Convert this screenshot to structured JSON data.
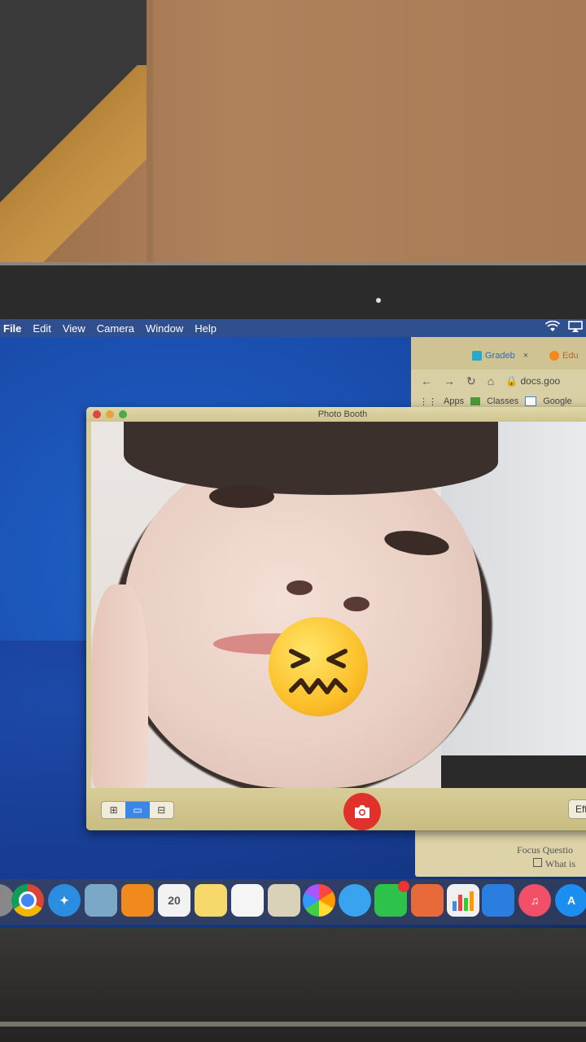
{
  "menubar": {
    "items": [
      "File",
      "Edit",
      "View",
      "Camera",
      "Window",
      "Help"
    ]
  },
  "chrome": {
    "tab1_label": "Gradeb",
    "tab1_close": "×",
    "tab2_label": "Edu",
    "url": "docs.goo",
    "bookmarks": [
      "Apps",
      "Classes",
      "Google"
    ]
  },
  "doc": {
    "line1": "Focus Questio",
    "line2": "What is"
  },
  "photobooth": {
    "title": "Photo Booth",
    "effects_label": "Effe"
  },
  "calendar": {
    "day": "20"
  },
  "colors": {
    "desktop_blue": "#1f63c8",
    "shutter_red": "#e0322b",
    "selected_blue": "#3c86e6"
  }
}
